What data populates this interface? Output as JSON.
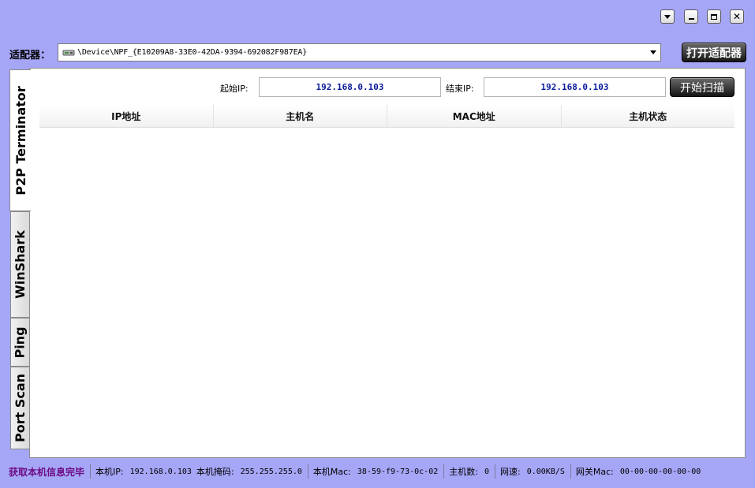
{
  "window": {
    "controls": {
      "dropdown": "chevron-down-icon",
      "minimize": "minimize-icon",
      "maximize": "maximize-icon",
      "close": "close-icon",
      "close_glyph": "✕"
    }
  },
  "adapter": {
    "label": "适配器：",
    "value": "\\Device\\NPF_{E10209A8-33E0-42DA-9394-692082F987EA}",
    "open_button": "打开适配器"
  },
  "tabs": [
    {
      "label": "P2P Terminator",
      "active": true
    },
    {
      "label": "WinShark",
      "active": false
    },
    {
      "label": "Ping",
      "active": false
    },
    {
      "label": "Port Scan",
      "active": false
    }
  ],
  "scan": {
    "start_ip_label": "起始IP:",
    "start_ip_value": "192.168.0.103",
    "end_ip_label": "结束IP:",
    "end_ip_value": "192.168.0.103",
    "start_button": "开始扫描"
  },
  "table": {
    "columns": [
      "IP地址",
      "主机名",
      "MAC地址",
      "主机状态"
    ],
    "rows": []
  },
  "status": {
    "message": "获取本机信息完毕",
    "local_ip_label": "本机IP:",
    "local_ip_value": "192.168.0.103",
    "mask_label": "本机掩码:",
    "mask_value": "255.255.255.0",
    "mac_label": "本机Mac:",
    "mac_value": "38-59-f9-73-0c-02",
    "host_count_label": "主机数:",
    "host_count_value": "0",
    "speed_label": "网速:",
    "speed_value": "0.00KB/S",
    "gateway_mac_label": "网关Mac:",
    "gateway_mac_value": "00-00-00-00-00-00"
  },
  "colors": {
    "background": "#a6a6f7",
    "ip_text": "#0b1b9c",
    "status_message": "#6d0d86",
    "button_dark": "#141414"
  }
}
